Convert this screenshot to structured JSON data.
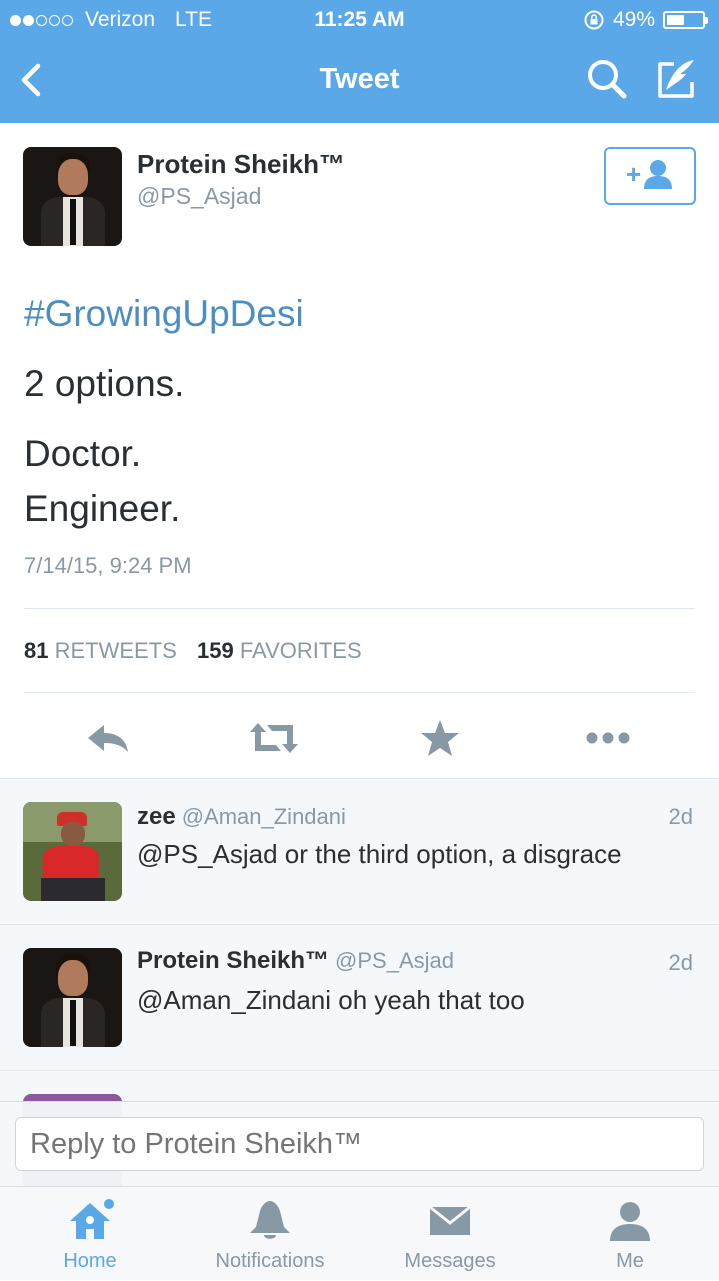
{
  "status_bar": {
    "carrier": "Verizon",
    "network": "LTE",
    "time": "11:25 AM",
    "battery": "49%",
    "battery_level": 0.49
  },
  "nav": {
    "title": "Tweet",
    "back_icon": "chevron-left-icon",
    "search_icon": "search-icon",
    "compose_icon": "compose-feather-icon"
  },
  "tweet": {
    "author_name": "Protein Sheikh™",
    "author_handle": "@PS_Asjad",
    "hashtag": "#GrowingUpDesi",
    "lines": [
      "2 options.",
      "Doctor.",
      "Engineer."
    ],
    "timestamp": "7/14/15, 9:24 PM",
    "retweets_count": "81",
    "retweets_label": "RETWEETS",
    "favorites_count": "159",
    "favorites_label": "FAVORITES",
    "actions": [
      "reply-icon",
      "retweet-icon",
      "favorite-star-icon",
      "more-dots-icon"
    ]
  },
  "replies": [
    {
      "name": "zee",
      "handle": "@Aman_Zindani",
      "time": "2d",
      "text": "@PS_Asjad or the third option, a disgrace"
    },
    {
      "name": "Protein Sheikh™",
      "handle": "@PS_Asjad",
      "time": "2d",
      "text": "@Aman_Zindani oh yeah that too"
    }
  ],
  "reply_box": {
    "placeholder": "Reply to Protein Sheikh™"
  },
  "tabs": [
    {
      "label": "Home",
      "icon": "home-icon",
      "active": true
    },
    {
      "label": "Notifications",
      "icon": "bell-icon",
      "active": false
    },
    {
      "label": "Messages",
      "icon": "envelope-icon",
      "active": false
    },
    {
      "label": "Me",
      "icon": "person-icon",
      "active": false
    }
  ],
  "colors": {
    "brand": "#5ba8e8",
    "hashtag": "#4a8ec2",
    "text": "#292f33",
    "muted": "#8899a6"
  }
}
